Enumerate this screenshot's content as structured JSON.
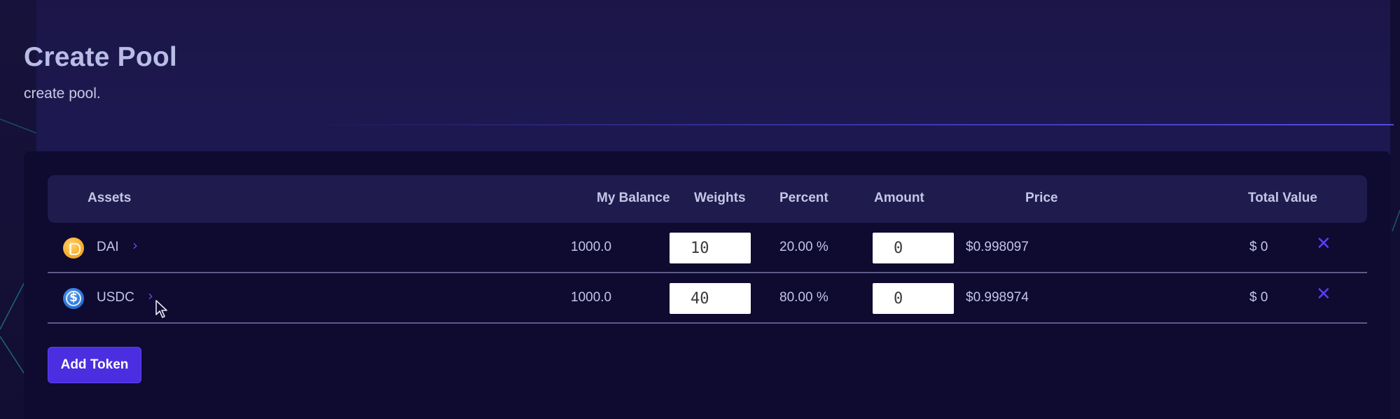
{
  "page": {
    "title": "Create Pool",
    "subtitle": "create pool."
  },
  "table": {
    "headers": {
      "assets": "Assets",
      "balance": "My Balance",
      "weights": "Weights",
      "percent": "Percent",
      "amount": "Amount",
      "price": "Price",
      "total_value": "Total Value"
    },
    "rows": [
      {
        "symbol": "DAI",
        "icon": "dai-token-icon",
        "chevron": "›",
        "balance": "1000.0",
        "weight": "10",
        "percent": "20.00 %",
        "amount": "0",
        "price": "$0.998097",
        "total_value": "$ 0",
        "remove": "✕"
      },
      {
        "symbol": "USDC",
        "icon": "usdc-token-icon",
        "chevron": "›",
        "balance": "1000.0",
        "weight": "40",
        "percent": "80.00 %",
        "amount": "0",
        "price": "$0.998974",
        "total_value": "$ 0",
        "remove": "✕"
      }
    ]
  },
  "actions": {
    "add_token_label": "Add Token"
  },
  "colors": {
    "background": "#1d1850",
    "card": "#0e0a30",
    "header_row": "#1f1b4d",
    "accent": "#4b2ee0",
    "remove_icon": "#5a3df5",
    "title_text": "#b9bde6"
  }
}
